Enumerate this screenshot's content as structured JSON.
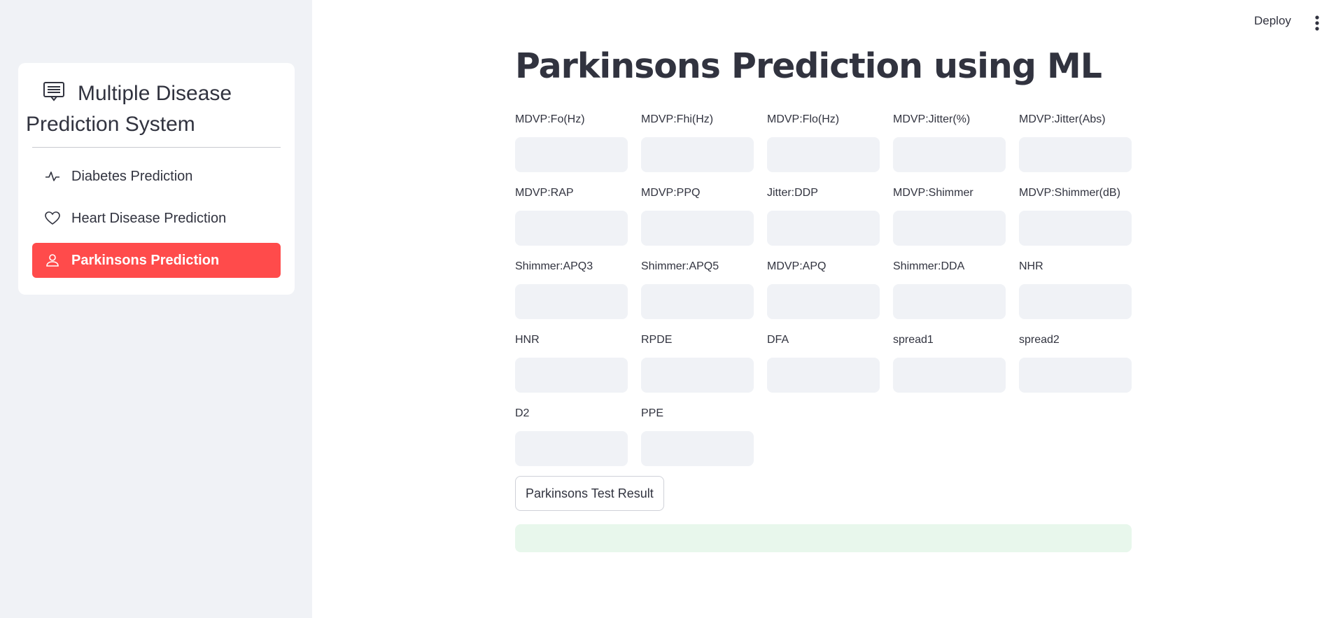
{
  "sidebar": {
    "menu_title_line1": "Multiple Disease",
    "menu_title_line2": "Prediction System",
    "header_icon": "newspaper-icon",
    "items": [
      {
        "label": "Diabetes Prediction",
        "icon": "activity-icon",
        "active": false
      },
      {
        "label": "Heart Disease Prediction",
        "icon": "heart-icon",
        "active": false
      },
      {
        "label": "Parkinsons Prediction",
        "icon": "person-icon",
        "active": true
      }
    ],
    "accent_color": "#ff4b4b"
  },
  "topbar": {
    "deploy_label": "Deploy",
    "menu_icon": "kebab-menu-icon"
  },
  "main": {
    "title": "Parkinsons Prediction using ML",
    "fields": [
      "MDVP:Fo(Hz)",
      "MDVP:Fhi(Hz)",
      "MDVP:Flo(Hz)",
      "MDVP:Jitter(%)",
      "MDVP:Jitter(Abs)",
      "MDVP:RAP",
      "MDVP:PPQ",
      "Jitter:DDP",
      "MDVP:Shimmer",
      "MDVP:Shimmer(dB)",
      "Shimmer:APQ3",
      "Shimmer:APQ5",
      "MDVP:APQ",
      "Shimmer:DDA",
      "NHR",
      "HNR",
      "RPDE",
      "DFA",
      "spread1",
      "spread2",
      "D2",
      "PPE"
    ],
    "result_button_label": "Parkinsons Test Result",
    "result_text": ""
  }
}
